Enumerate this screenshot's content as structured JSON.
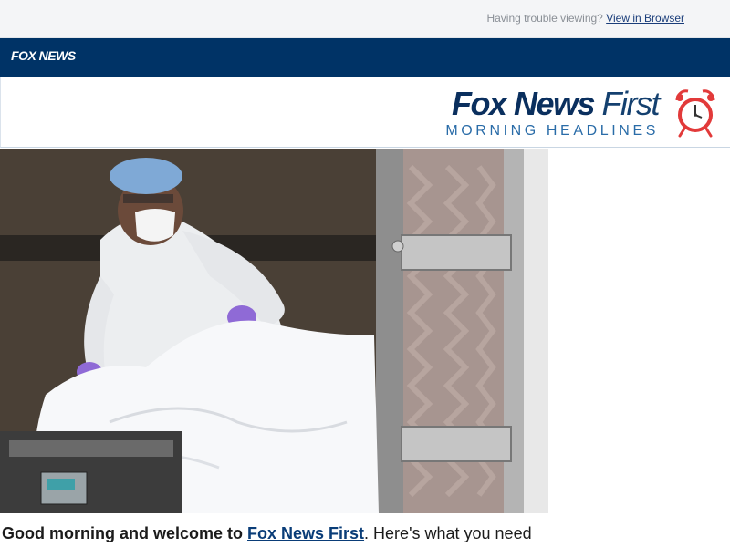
{
  "topbar": {
    "trouble_text": "Having trouble viewing?",
    "view_link": "View in Browser"
  },
  "navbar": {
    "logo_text": "FOX NEWS"
  },
  "header": {
    "title_bold": "Fox News",
    "title_light": "First",
    "subtitle": "MORNING HEADLINES",
    "icon": "alarm-clock-icon"
  },
  "hero": {
    "image": "worker-in-protective-suit-photo"
  },
  "intro": {
    "greeting": "Good morning and welcome to ",
    "link_text": "Fox News First",
    "rest": ". Here's what you need"
  },
  "colors": {
    "navy": "#003366",
    "accent_blue": "#2a6ca8",
    "alarm_red": "#e23a3a"
  }
}
